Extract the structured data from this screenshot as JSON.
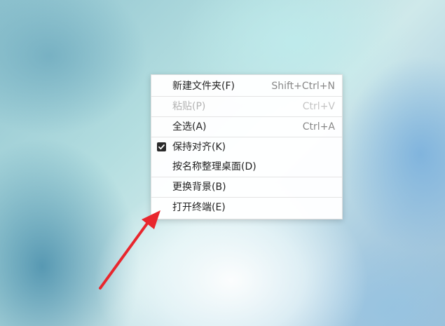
{
  "context_menu": {
    "items": [
      {
        "label": "新建文件夹(F)",
        "shortcut": "Shift+Ctrl+N"
      },
      {
        "label": "粘贴(P)",
        "shortcut": "Ctrl+V"
      },
      {
        "label": "全选(A)",
        "shortcut": "Ctrl+A"
      },
      {
        "label": "保持对齐(K)",
        "shortcut": ""
      },
      {
        "label": "按名称整理桌面(D)",
        "shortcut": ""
      },
      {
        "label": "更换背景(B)",
        "shortcut": ""
      },
      {
        "label": "打开终端(E)",
        "shortcut": ""
      }
    ],
    "disabled_item": "粘贴(P)",
    "checked_item": "保持对齐(K)"
  },
  "annotation": {
    "arrow_color": "#e8262d"
  }
}
